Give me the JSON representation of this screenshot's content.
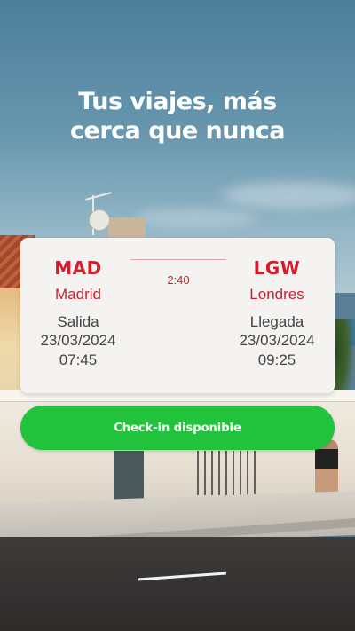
{
  "hero": {
    "line1": "Tus viajes, más",
    "line2": "cerca que nunca"
  },
  "flight": {
    "origin": {
      "code": "MAD",
      "city": "Madrid",
      "label": "Salida",
      "date": "23/03/2024",
      "time": "07:45"
    },
    "destination": {
      "code": "LGW",
      "city": "Londres",
      "label": "Llegada",
      "date": "23/03/2024",
      "time": "09:25"
    },
    "duration": "2:40"
  },
  "checkin": {
    "label": "Check-in disponible"
  },
  "colors": {
    "accent": "#d21e2c",
    "button": "#20c33b",
    "card": "#f4f3f2"
  }
}
